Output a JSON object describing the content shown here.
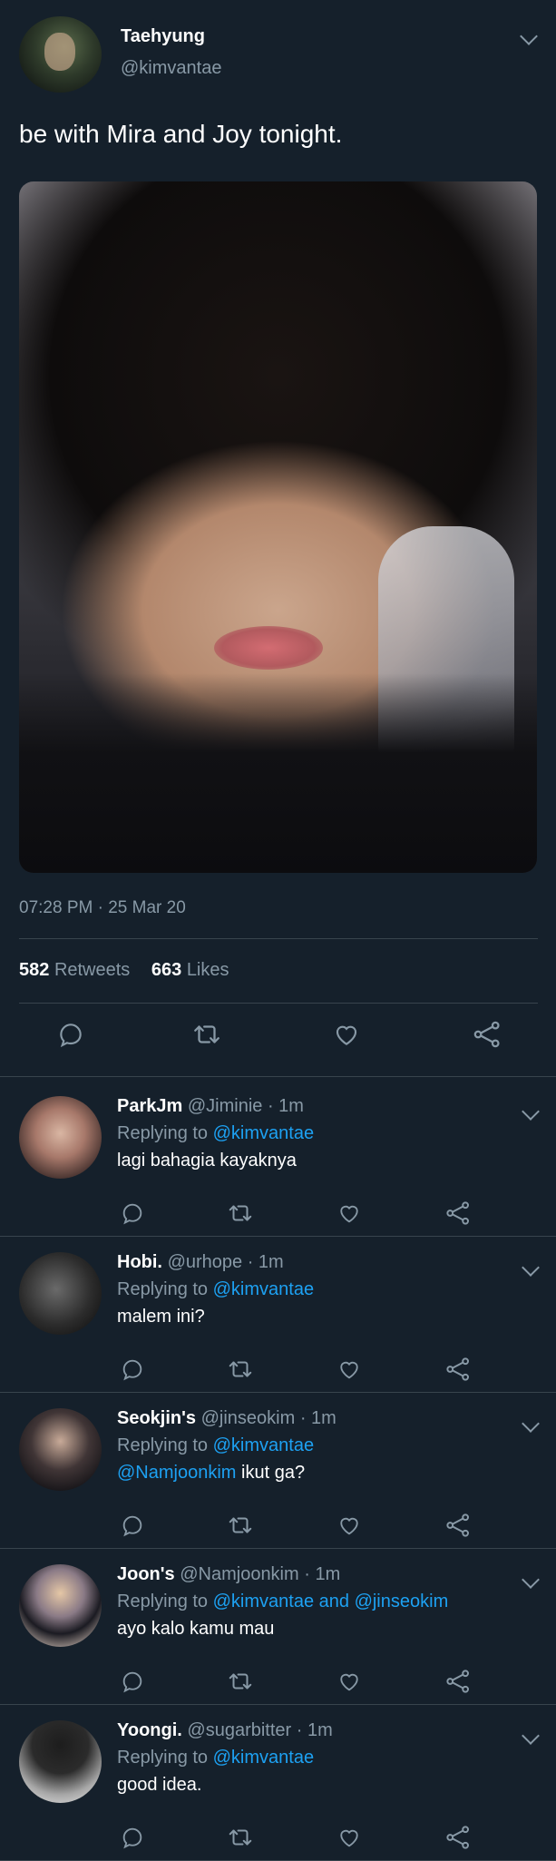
{
  "tweet": {
    "author_name": "Taehyung",
    "author_handle": "@kimvantae",
    "text": "be with Mira and Joy tonight.",
    "timestamp": "07:28 PM · 25 Mar 20",
    "retweets_count": "582",
    "retweets_label": "Retweets",
    "likes_count": "663",
    "likes_label": "Likes"
  },
  "replies": [
    {
      "name": "ParkJm",
      "handle": "@Jiminie",
      "time": "· 1m",
      "replying_label": "Replying to",
      "replying_to": "@kimvantae",
      "text": "lagi bahagia kayaknya"
    },
    {
      "name": "Hobi.",
      "handle": "@urhope",
      "time": "· 1m",
      "replying_label": "Replying to",
      "replying_to": "@kimvantae",
      "text": "malem ini?"
    },
    {
      "name": "Seokjin's",
      "handle": "@jinseokim",
      "time": "· 1m",
      "replying_label": "Replying to",
      "replying_to": "@kimvantae",
      "mention": "@Namjoonkim",
      "text": "ikut ga?"
    },
    {
      "name": "Joon's",
      "handle": "@Namjoonkim",
      "time": "· 1m",
      "replying_label": "Replying to",
      "replying_to": "@kimvantae and @jinseokim",
      "text": "ayo kalo kamu mau"
    },
    {
      "name": "Yoongi.",
      "handle": "@sugarbitter",
      "time": "· 1m",
      "replying_label": "Replying to",
      "replying_to": "@kimvantae",
      "text": "good idea."
    }
  ],
  "icons": {
    "reply": "reply-icon",
    "retweet": "retweet-icon",
    "like": "heart-icon",
    "share": "share-icon",
    "more": "chevron-down-icon"
  },
  "colors": {
    "background": "#15202b",
    "muted": "#8899a6",
    "link": "#1da1f2",
    "divider": "#38444d"
  }
}
